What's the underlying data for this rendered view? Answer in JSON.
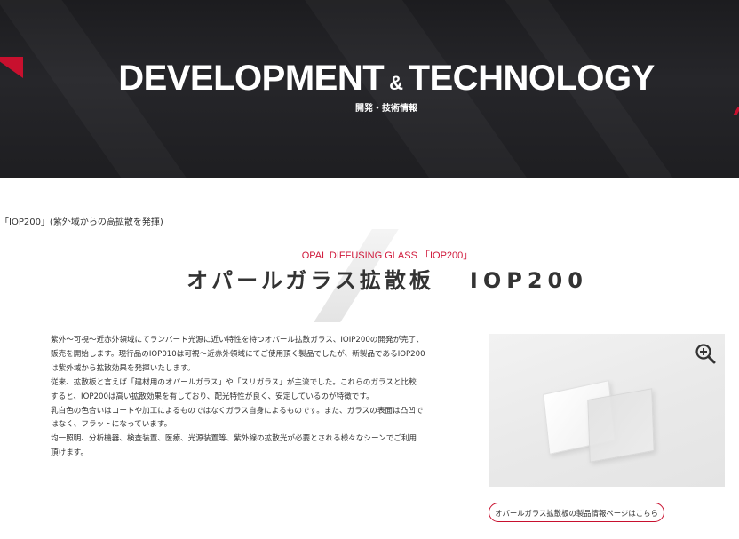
{
  "hero": {
    "title_left": "DEVELOPMENT",
    "title_amp": "&",
    "title_right": "TECHNOLOGY",
    "subtitle": "開発・技術情報"
  },
  "breadcrumb": "「IOP200」(紫外域からの高拡散を発揮)",
  "heading": {
    "subtitle": "OPAL DIFFUSING GLASS 「IOP200」",
    "title": "オパールガラス拡散板",
    "model": "IOP200"
  },
  "description": [
    "紫外～可視～近赤外領域にてランバート光源に近い特性を持つオパール拡散ガラス、IOIP200の開発が完了、",
    "販売を開始します。現行品のIOP010は可視～近赤外領域にてご使用頂く製品でしたが、新製品であるIOP200",
    "は紫外域から拡散効果を発揮いたします。",
    "従来、拡散板と言えば「建材用のオパールガラス」や「スリガラス」が主流でした。これらのガラスと比較",
    "すると、IOP200は高い拡散効果を有しており、配光特性が良く、安定しているのが特徴です。",
    "乳白色の色合いはコートや加工によるものではなくガラス自身によるものです。また、ガラスの表面は凸凹で",
    "はなく、フラットになっています。",
    "均一照明、分析機器、検査装置、医療、光源装置等、紫外線の拡散光が必要とされる様々なシーンでご利用",
    "頂けます。"
  ],
  "product_link": "オパールガラス拡散板の製品情報ページはこちら",
  "icons": {
    "zoom": "zoom-in-icon"
  },
  "colors": {
    "accent": "#c8102e",
    "hero_bg": "#222225"
  }
}
